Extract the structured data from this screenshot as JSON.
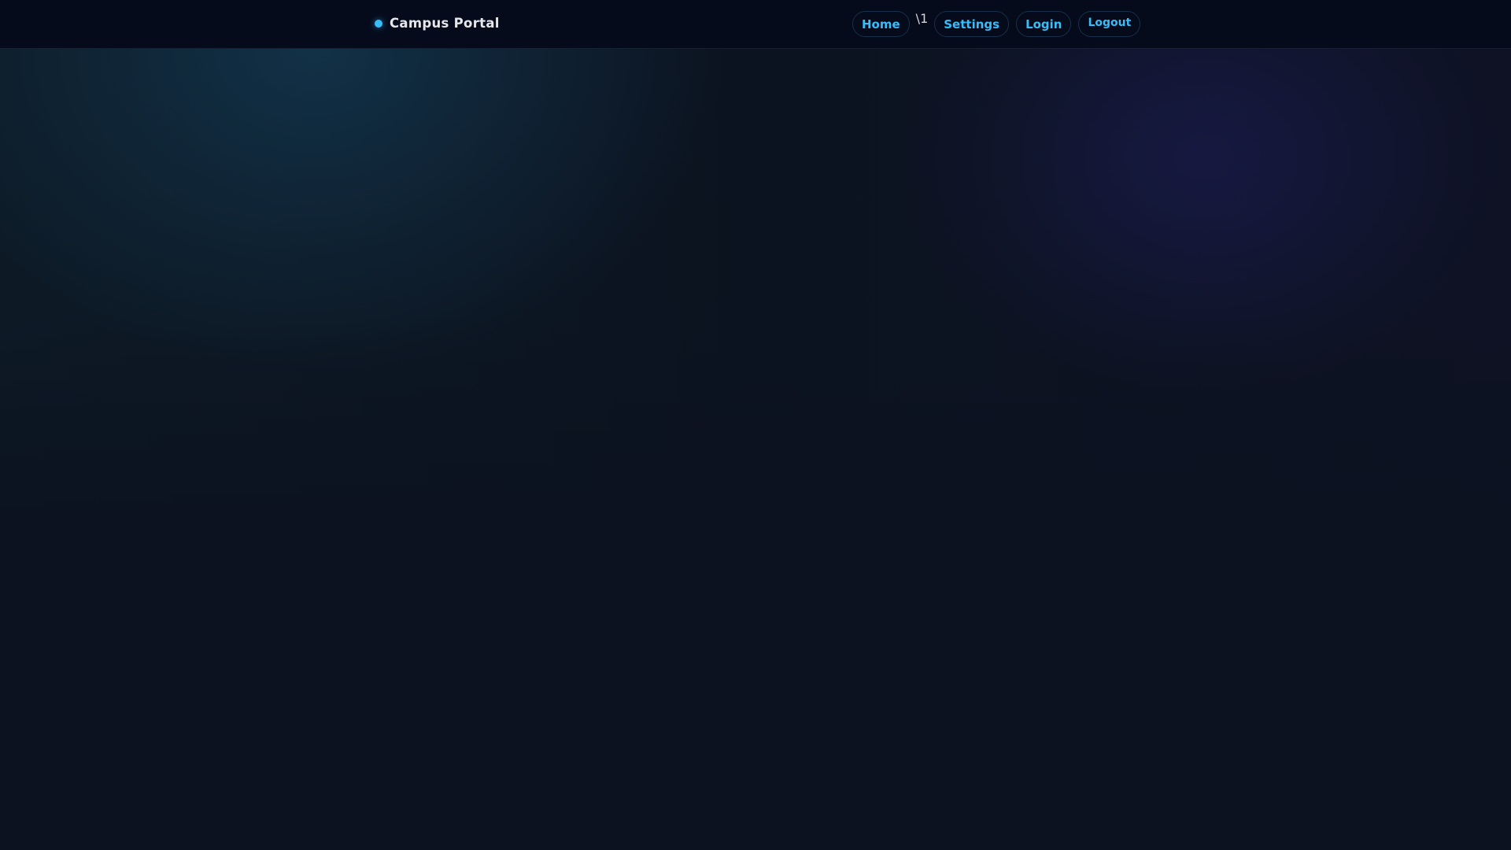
{
  "header": {
    "brand": "Campus Portal",
    "nav": {
      "home": "Home",
      "stray_text": "\\1",
      "settings": "Settings",
      "login": "Login",
      "logout": "Logout"
    }
  },
  "colors": {
    "accent": "#38bdf8",
    "background": "#0c1220",
    "header": "#060b1c"
  }
}
